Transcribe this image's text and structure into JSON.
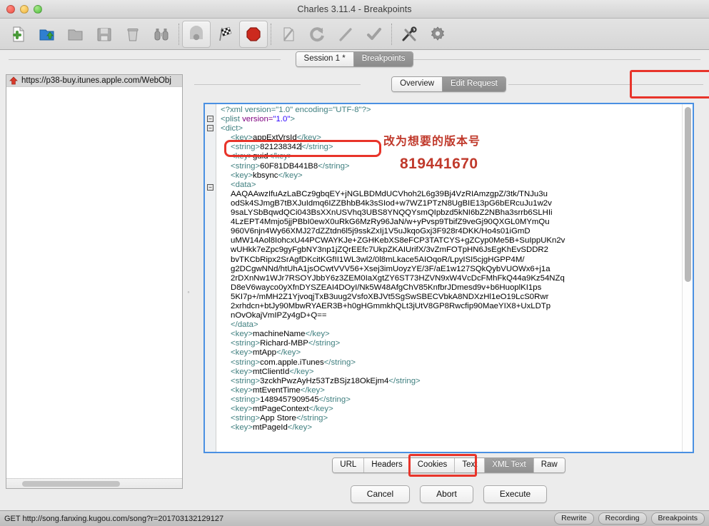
{
  "window": {
    "title": "Charles 3.11.4 - Breakpoints"
  },
  "toolbar": {
    "buttons": [
      {
        "name": "new-session",
        "icon": "new-document-icon"
      },
      {
        "name": "open-session",
        "icon": "open-folder-icon"
      },
      {
        "name": "close-session",
        "icon": "folder-icon"
      },
      {
        "name": "save-session",
        "icon": "floppy-save-icon"
      },
      {
        "name": "clear-session",
        "icon": "trash-icon"
      },
      {
        "name": "find",
        "icon": "binoculars-icon"
      },
      {
        "name": "throttle",
        "icon": "throttle-icon"
      },
      {
        "name": "breakpoints",
        "icon": "checkered-flag-icon"
      },
      {
        "name": "record-stop",
        "icon": "record-stop-icon"
      },
      {
        "name": "compose",
        "icon": "compose-pencil-icon"
      },
      {
        "name": "repeat",
        "icon": "repeat-refresh-icon"
      },
      {
        "name": "validate",
        "icon": "slash-line-icon"
      },
      {
        "name": "check",
        "icon": "checkmark-icon"
      },
      {
        "name": "tools",
        "icon": "tools-wrench-icon"
      },
      {
        "name": "settings",
        "icon": "gear-icon"
      }
    ]
  },
  "session_tabs": {
    "items": [
      {
        "label": "Session 1 *",
        "active": false
      },
      {
        "label": "Breakpoints",
        "active": true
      }
    ]
  },
  "sidebar": {
    "tree": [
      {
        "label": "https://p38-buy.itunes.apple.com/WebObj",
        "icon": "red-up-arrow-icon"
      }
    ]
  },
  "view_tabs": {
    "items": [
      {
        "label": "Overview",
        "active": false
      },
      {
        "label": "Edit Request",
        "active": true
      }
    ]
  },
  "editor": {
    "lines": [
      {
        "indent": 0,
        "parts": [
          {
            "c": "pi",
            "t": "<?xml version=\"1.0\" encoding=\"UTF-8\"?>"
          }
        ]
      },
      {
        "indent": 0,
        "parts": [
          {
            "c": "tag",
            "t": "<plist "
          },
          {
            "c": "attr",
            "t": "version="
          },
          {
            "c": "val",
            "t": "\"1.0\""
          },
          {
            "c": "tag",
            "t": ">"
          }
        ]
      },
      {
        "indent": 0,
        "parts": [
          {
            "c": "tag",
            "t": "<dict>"
          }
        ]
      },
      {
        "indent": 1,
        "parts": [
          {
            "c": "tag",
            "t": "<key>"
          },
          {
            "c": "txt",
            "t": "appExtVrsId"
          },
          {
            "c": "tag",
            "t": "</key>"
          }
        ]
      },
      {
        "indent": 1,
        "parts": [
          {
            "c": "tag",
            "t": "<string>"
          },
          {
            "c": "txt",
            "t": "821238342"
          },
          {
            "c": "caret",
            "t": ""
          },
          {
            "c": "tag",
            "t": "</string>"
          }
        ]
      },
      {
        "indent": 1,
        "parts": [
          {
            "c": "tag",
            "t": "<key>"
          },
          {
            "c": "txt",
            "t": "guid"
          },
          {
            "c": "tag",
            "t": "</key>"
          }
        ]
      },
      {
        "indent": 1,
        "parts": [
          {
            "c": "tag",
            "t": "<string>"
          },
          {
            "c": "txt",
            "t": "60F81DB441B8"
          },
          {
            "c": "tag",
            "t": "</string>"
          }
        ]
      },
      {
        "indent": 1,
        "parts": [
          {
            "c": "tag",
            "t": "<key>"
          },
          {
            "c": "txt",
            "t": "kbsync"
          },
          {
            "c": "tag",
            "t": "</key>"
          }
        ]
      },
      {
        "indent": 1,
        "parts": [
          {
            "c": "tag",
            "t": "<data>"
          }
        ]
      },
      {
        "indent": 1,
        "parts": [
          {
            "c": "b64",
            "t": "AAQAAwzIfuAzLaBCz9gbqEY+jNGLBDMdUCVhoh2L6g39Bj4VzRIAmzgpZ/3tk/TNJu3u"
          }
        ]
      },
      {
        "indent": 1,
        "parts": [
          {
            "c": "b64",
            "t": "odSk4SJmgB7tBXJuIdmq6IZZBhbB4k3sSIod+w7WZ1PTzN8UgBIE13pG6bERcuJu1w2v"
          }
        ]
      },
      {
        "indent": 1,
        "parts": [
          {
            "c": "b64",
            "t": "9saLYSbBqwdQCi043BsXXnUSVhq3UBS8YNQQYsmQIpbzd5kNI6bZ2NBha3srrb6SLHIi"
          }
        ]
      },
      {
        "indent": 1,
        "parts": [
          {
            "c": "b64",
            "t": "4LzEPT4Mmjo5jjPBbI0ewX0uRkG6MzRy96JaN/w+yPvsp9TbifZ9veGj90QXGL0MYmQu"
          }
        ]
      },
      {
        "indent": 1,
        "parts": [
          {
            "c": "b64",
            "t": "960V6njn4Wy66XMJ27dZZtdn6l5j9sskZxIj1V5uJkqoGxj3F928r4DKK/Ho4s01iGmD"
          }
        ]
      },
      {
        "indent": 1,
        "parts": [
          {
            "c": "b64",
            "t": "uMW14Aol8IohcxU44PCWAYKJe+ZGHKebXS8eFCP3TATCYS+gZCyp0Me5B+SuIppUKn2v"
          }
        ]
      },
      {
        "indent": 1,
        "parts": [
          {
            "c": "b64",
            "t": "wUHkk7eZpc9gyFgbNY3np1jZQrEEfc7UkpZKAIUrifX/3vZmFOTpHN6JsEgKhEvSDDR2"
          }
        ]
      },
      {
        "indent": 1,
        "parts": [
          {
            "c": "b64",
            "t": "bvTKCbRipx2SrAgfDKcitKGfII1WL3wl2/0l8mLkace5AIOqoR/LpyISI5cjgHGPP4M/"
          }
        ]
      },
      {
        "indent": 1,
        "parts": [
          {
            "c": "b64",
            "t": "g2DCgwNNd/htUhA1jsOCwtVVV56+Xsej3imUoyzYE/3F/aE1w127SQkQybVUOWx6+j1a"
          }
        ]
      },
      {
        "indent": 1,
        "parts": [
          {
            "c": "b64",
            "t": "2rDXnNw1WJr7RSOYJbbY6z3ZEM0IaXgtZY6ST73HZVN9xW4VcDcFMhFkQ44a9Kz54NZq"
          }
        ]
      },
      {
        "indent": 1,
        "parts": [
          {
            "c": "b64",
            "t": "D8eV6wayco0yXfnDYSZEAI4DOyI/Nk5W48AfgChV85KnfbrJDmesd9v+b6HuoplKI1ps"
          }
        ]
      },
      {
        "indent": 1,
        "parts": [
          {
            "c": "b64",
            "t": "5KI7p+/mMH2Z1YjvoqjTxB3uug2VsfoXBJVt5SgSwSBECVbkA8NDXzHl1eO19LcS0Rwr"
          }
        ]
      },
      {
        "indent": 1,
        "parts": [
          {
            "c": "b64",
            "t": "2xrhdcn+btJy90MbwRYAER3B+h0gHGmmkhQLt3jUtV8GP8Rwcfip90MaeYIX8+UxLDTp"
          }
        ]
      },
      {
        "indent": 1,
        "parts": [
          {
            "c": "b64",
            "t": "nOvOkajVmIPZy4gD+Q=="
          }
        ]
      },
      {
        "indent": 1,
        "parts": [
          {
            "c": "tag",
            "t": "</data>"
          }
        ]
      },
      {
        "indent": 1,
        "parts": [
          {
            "c": "tag",
            "t": "<key>"
          },
          {
            "c": "txt",
            "t": "machineName"
          },
          {
            "c": "tag",
            "t": "</key>"
          }
        ]
      },
      {
        "indent": 1,
        "parts": [
          {
            "c": "tag",
            "t": "<string>"
          },
          {
            "c": "txt",
            "t": "Richard-MBP"
          },
          {
            "c": "tag",
            "t": "</string>"
          }
        ]
      },
      {
        "indent": 1,
        "parts": [
          {
            "c": "tag",
            "t": "<key>"
          },
          {
            "c": "txt",
            "t": "mtApp"
          },
          {
            "c": "tag",
            "t": "</key>"
          }
        ]
      },
      {
        "indent": 1,
        "parts": [
          {
            "c": "tag",
            "t": "<string>"
          },
          {
            "c": "txt",
            "t": "com.apple.iTunes"
          },
          {
            "c": "tag",
            "t": "</string>"
          }
        ]
      },
      {
        "indent": 1,
        "parts": [
          {
            "c": "tag",
            "t": "<key>"
          },
          {
            "c": "txt",
            "t": "mtClientId"
          },
          {
            "c": "tag",
            "t": "</key>"
          }
        ]
      },
      {
        "indent": 1,
        "parts": [
          {
            "c": "tag",
            "t": "<string>"
          },
          {
            "c": "txt",
            "t": "3zckhPwzAyHz53TzBSjz18OkEjm4"
          },
          {
            "c": "tag",
            "t": "</string>"
          }
        ]
      },
      {
        "indent": 1,
        "parts": [
          {
            "c": "tag",
            "t": "<key>"
          },
          {
            "c": "txt",
            "t": "mtEventTime"
          },
          {
            "c": "tag",
            "t": "</key>"
          }
        ]
      },
      {
        "indent": 1,
        "parts": [
          {
            "c": "tag",
            "t": "<string>"
          },
          {
            "c": "txt",
            "t": "1489457909545"
          },
          {
            "c": "tag",
            "t": "</string>"
          }
        ]
      },
      {
        "indent": 1,
        "parts": [
          {
            "c": "tag",
            "t": "<key>"
          },
          {
            "c": "txt",
            "t": "mtPageContext"
          },
          {
            "c": "tag",
            "t": "</key>"
          }
        ]
      },
      {
        "indent": 1,
        "parts": [
          {
            "c": "tag",
            "t": "<string>"
          },
          {
            "c": "txt",
            "t": "App Store"
          },
          {
            "c": "tag",
            "t": "</string>"
          }
        ]
      },
      {
        "indent": 1,
        "parts": [
          {
            "c": "tag",
            "t": "<key>"
          },
          {
            "c": "txt",
            "t": "mtPageId"
          },
          {
            "c": "tag",
            "t": "</key>"
          }
        ]
      }
    ]
  },
  "annotations": {
    "chinese_note": "改为想要的版本号",
    "target_version": "819441670",
    "color": "#c0392b"
  },
  "format_tabs": {
    "items": [
      {
        "label": "URL",
        "active": false
      },
      {
        "label": "Headers",
        "active": false
      },
      {
        "label": "Cookies",
        "active": false
      },
      {
        "label": "Text",
        "active": false
      },
      {
        "label": "XML Text",
        "active": true
      },
      {
        "label": "Raw",
        "active": false
      }
    ]
  },
  "actions": {
    "cancel": "Cancel",
    "abort": "Abort",
    "execute": "Execute"
  },
  "statusbar": {
    "request": "GET http://song.fanxing.kugou.com/song?r=201703132129127",
    "pills": [
      "Rewrite",
      "Recording",
      "Breakpoints"
    ]
  }
}
